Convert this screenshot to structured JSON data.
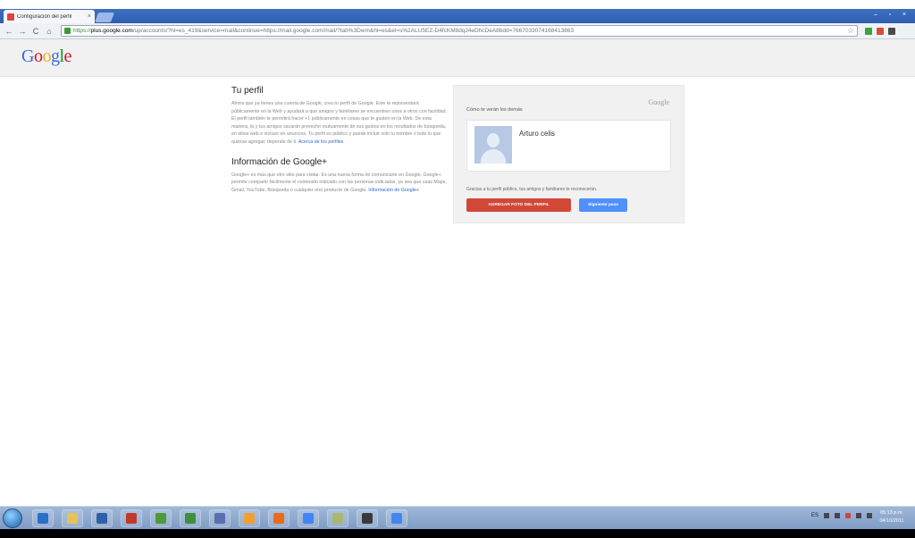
{
  "browser": {
    "tab_title": "Configuración del perfil",
    "tab_close": "×",
    "window_controls": [
      "–",
      "▫",
      "×"
    ],
    "nav": {
      "back": "←",
      "forward": "→",
      "reload": "C",
      "home": "⌂"
    },
    "url": {
      "protocol": "https://",
      "host": "plus.google.com",
      "rest": "/up/accounts/?hl=es_419&service=mail&continue=https://mail.google.com/mail/?tab%3Dwm&hl=es&el=s%2ALU5EZ-D4fcKM8dqJ4eDhcDeA8bdd=7667033074168413863"
    },
    "star": "☆",
    "extension_colors": [
      "#3aa53a",
      "#d94c3d",
      "#4b4b4b"
    ]
  },
  "header": {
    "logo_letters": [
      "G",
      "o",
      "o",
      "g",
      "l",
      "e"
    ],
    "logo_colors": [
      "#3369e8",
      "#d50f25",
      "#eeb211",
      "#3369e8",
      "#009925",
      "#d50f25"
    ]
  },
  "profile_section": {
    "title": "Tu perfil",
    "body": "Ahora que ya tienes una cuenta de Google, crea tu perfil de Google. Este te representará públicamente en la Web y ayudará a que amigos y familiares se encuentren unos a otros con facilidad. El perfil también te permitirá hacer +1 públicamente en cosas que te gusten en la Web. De esta manera, tú y tus amigos sacarán provecho mutuamente de sus gustos en los resultados de búsqueda, en sitios web e incluso en anuncios. Tu perfil es público y puede incluir solo tu nombre o todo lo que quieras agregar; depende de ti.",
    "link": "Acerca de los perfiles"
  },
  "gplus_section": {
    "title": "Información de Google+",
    "body": "Google+ es más que otro sitio para visitar. Es una nueva forma de comunicarte en Google. Google+ permite compartir fácilmente el contenido indicado con las personas indicadas, ya sea que usas Maps, Gmail, YouTube, Búsqueda o cualquier otro producto de Google.",
    "link": "Información de Google+"
  },
  "preview": {
    "google_mark": "Google",
    "title": "Cómo te verán los demás",
    "name": "Arturo celis",
    "note": "Gracias a tu perfil público, tus amigos y familiares te reconocerán.",
    "add_photo_button": "AGREGAR FOTO DEL PERFIL",
    "next_button": "Siguiente paso"
  },
  "taskbar": {
    "app_icon_colors": [
      "#2a6fc9",
      "#e7c15a",
      "#2f5fa8",
      "#c0392b",
      "#4e9a3a",
      "#3f8f3f",
      "#5a6fb0",
      "#f0a030",
      "#e86b1c",
      "#4285f4",
      "#a8b870",
      "#3a3a3a",
      "#4285f4"
    ],
    "tray_text": "ES",
    "time": "05:13 p.m.",
    "date": "04/10/2011"
  }
}
